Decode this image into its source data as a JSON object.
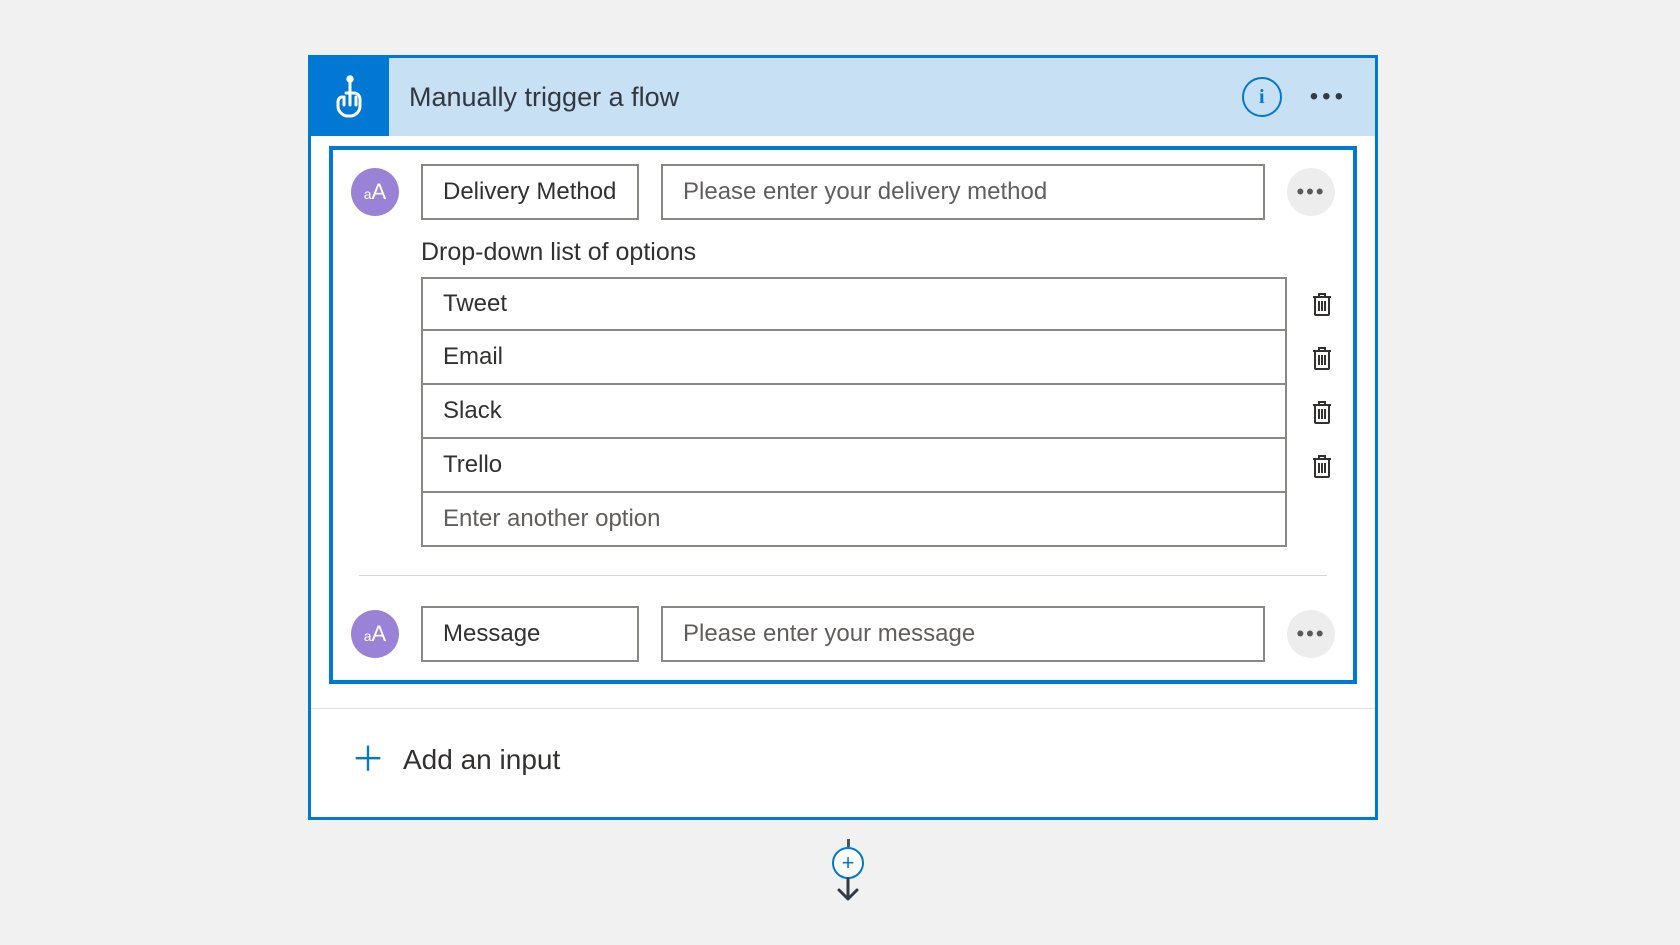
{
  "card": {
    "title": "Manually trigger a flow",
    "info_letter": "i"
  },
  "inputs": [
    {
      "badge": "aA",
      "name": "Delivery Method",
      "placeholder": "Please enter your delivery method",
      "dropdown": {
        "label": "Drop-down list of options",
        "options": [
          "Tweet",
          "Email",
          "Slack",
          "Trello"
        ],
        "add_placeholder": "Enter another option"
      }
    },
    {
      "badge": "aA",
      "name": "Message",
      "placeholder": "Please enter your message"
    }
  ],
  "add_input_label": "Add an input"
}
